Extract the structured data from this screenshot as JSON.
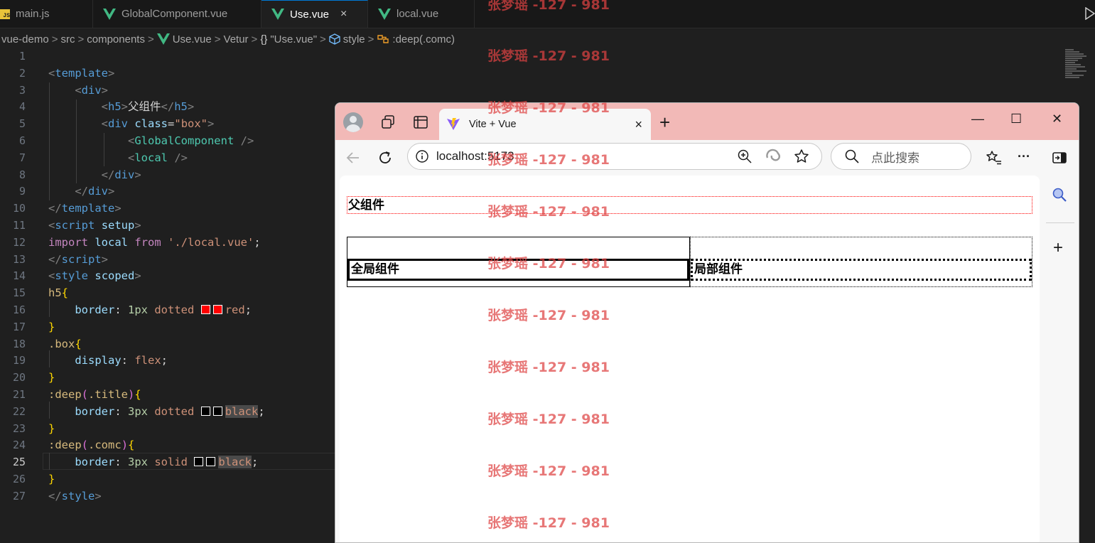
{
  "editor": {
    "tabs": [
      {
        "label": "main.js",
        "icon": "js-file-icon",
        "icon_text": "JS"
      },
      {
        "label": "GlobalComponent.vue",
        "icon": "vue-file-icon"
      },
      {
        "label": "Use.vue",
        "icon": "vue-file-icon",
        "active": true,
        "close": "×"
      },
      {
        "label": "local.vue",
        "icon": "vue-file-icon"
      }
    ],
    "breadcrumb": [
      "vue-demo",
      "src",
      "components",
      "Use.vue",
      "Vetur",
      "\"Use.vue\"",
      "style",
      ":deep(.comc)"
    ],
    "breadcrumb_symbols": {
      "object": "{}",
      "sep": ">"
    },
    "line_numbers": [
      "1",
      "2",
      "3",
      "4",
      "5",
      "6",
      "7",
      "8",
      "9",
      "10",
      "11",
      "12",
      "13",
      "14",
      "15",
      "16",
      "17",
      "18",
      "19",
      "20",
      "21",
      "22",
      "23",
      "24",
      "25",
      "26",
      "27"
    ],
    "current_line": 25,
    "code": {
      "template_open": "template",
      "div": "div",
      "h5": "h5",
      "h5_text": "父组件",
      "class_attr": "class",
      "box_str": "\"box\"",
      "global_comp": "GlobalComponent",
      "local_tag": "local",
      "script": "script",
      "setup": "setup",
      "import_kw": "import",
      "local_name": "local",
      "from_kw": "from",
      "import_path": "'./local.vue'",
      "style": "style",
      "scoped": "scoped",
      "sel_h5": "h5",
      "prop_border": "border",
      "val_1px": "1px",
      "val_dotted": "dotted",
      "val_red": "red",
      "sel_box": ".box",
      "prop_display": "display",
      "val_flex": "flex",
      "sel_deep": ":deep",
      "sel_title": ".title",
      "val_3px": "3px",
      "val_black": "black",
      "sel_comc": ".comc",
      "val_solid": "solid"
    },
    "colors": {
      "red_swatch": "#ff0000",
      "black_swatch": "#000000"
    }
  },
  "browser": {
    "tab_title": "Vite + Vue",
    "tab_close": "×",
    "new_tab": "+",
    "address": "localhost:5173",
    "search_placeholder": "点此搜索",
    "window_controls": {
      "minimize": "—",
      "maximize": "☐",
      "close": "✕"
    },
    "more_menu": "···",
    "sidebar_add": "+",
    "page": {
      "heading": "父组件",
      "global_component": "全局组件",
      "local_component": "局部组件"
    },
    "titlebar_color": "#f2b9b7"
  },
  "watermark": {
    "text": "张梦瑶 -127 - 981",
    "color": "#de4242"
  }
}
